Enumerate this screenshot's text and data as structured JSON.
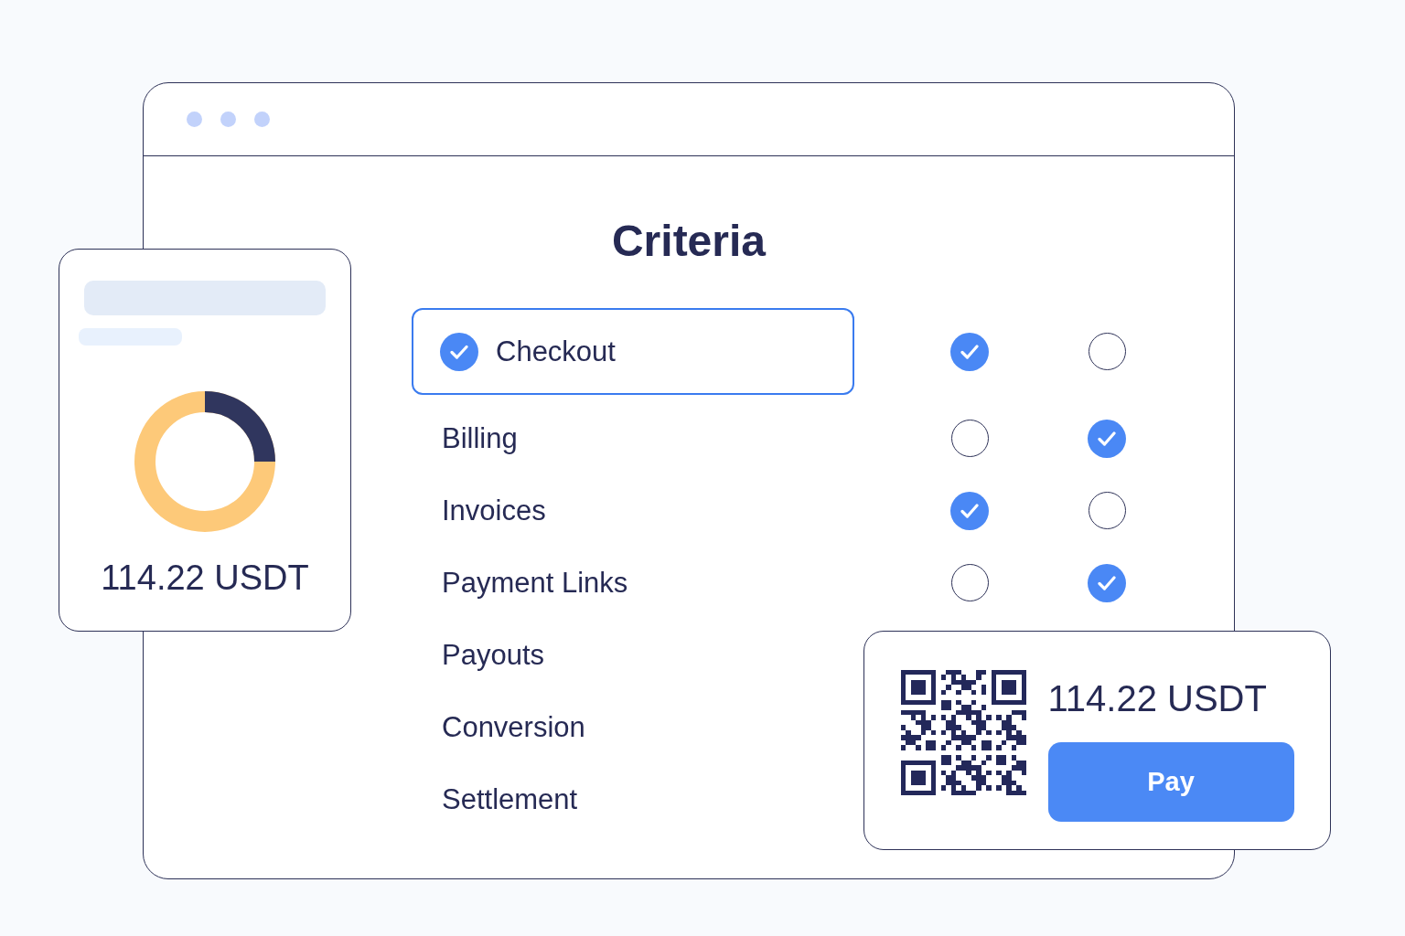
{
  "criteria": {
    "title": "Criteria",
    "rows": [
      {
        "label": "Checkout",
        "selected": true,
        "options": [
          {
            "checked": true
          },
          {
            "checked": false
          }
        ]
      },
      {
        "label": "Billing",
        "selected": false,
        "options": [
          {
            "checked": false
          },
          {
            "checked": true
          }
        ]
      },
      {
        "label": "Invoices",
        "selected": false,
        "options": [
          {
            "checked": true
          },
          {
            "checked": false
          }
        ]
      },
      {
        "label": "Payment Links",
        "selected": false,
        "options": [
          {
            "checked": false
          },
          {
            "checked": true
          }
        ]
      },
      {
        "label": "Payouts",
        "selected": false
      },
      {
        "label": "Conversion",
        "selected": false
      },
      {
        "label": "Settlement",
        "selected": false
      }
    ]
  },
  "balance_card": {
    "amount": "114.22 USDT"
  },
  "payment_card": {
    "amount": "114.22 USDT",
    "pay_button": "Pay"
  }
}
